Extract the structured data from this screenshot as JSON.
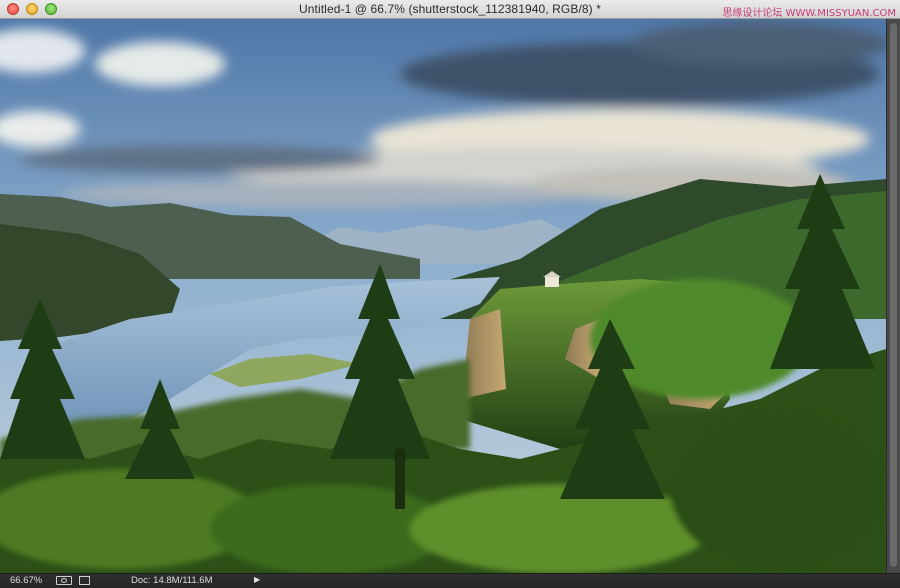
{
  "window": {
    "title": "Untitled-1 @ 66.7% (shutterstock_112381940, RGB/8) *",
    "watermark": "思缘设计论坛 WWW.MISSYUAN.COM"
  },
  "canvas": {
    "description_icon": "landscape-photo"
  },
  "statusbar": {
    "zoom": "66.67%",
    "doc": "Doc: 14.8M/111.6M",
    "arrow": "▶"
  },
  "colors": {
    "titlebar": "#dedede",
    "statusbar": "#2b2b2b",
    "sky_top": "#5d84b4",
    "river": "#7da0c7",
    "forest": "#2f5a1e"
  }
}
